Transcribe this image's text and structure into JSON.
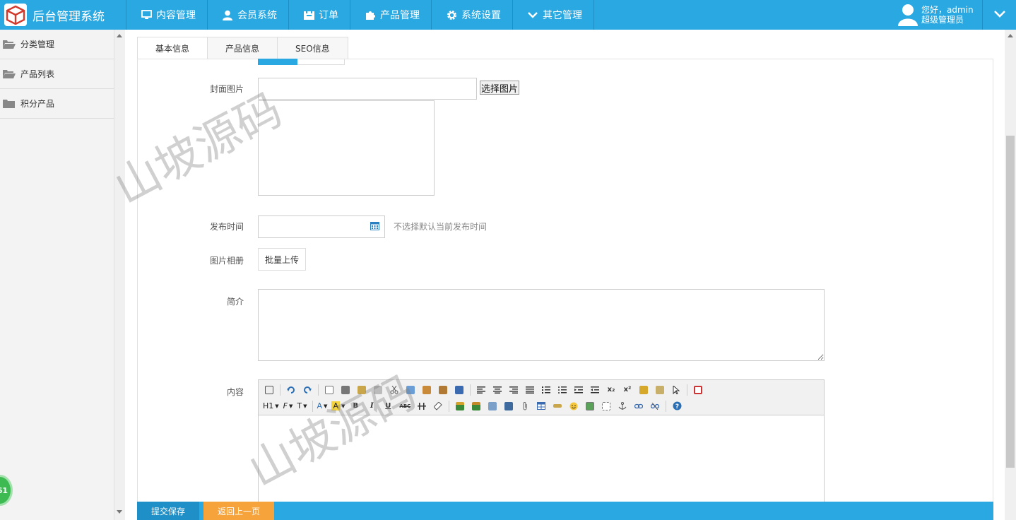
{
  "app": {
    "title": "后台管理系统"
  },
  "nav": {
    "items": [
      {
        "label": "内容管理",
        "icon": "monitor-icon"
      },
      {
        "label": "会员系统",
        "icon": "user-icon"
      },
      {
        "label": "订单",
        "icon": "order-icon"
      },
      {
        "label": "产品管理",
        "icon": "puzzle-icon"
      },
      {
        "label": "系统设置",
        "icon": "gear-icon"
      },
      {
        "label": "其它管理",
        "icon": "chevron-down-icon"
      }
    ]
  },
  "user": {
    "greeting": "您好，admin",
    "role": "超级管理员"
  },
  "sidebar": {
    "items": [
      {
        "label": "分类管理",
        "icon": "folder-open-icon"
      },
      {
        "label": "产品列表",
        "icon": "folder-open-icon"
      },
      {
        "label": "积分产品",
        "icon": "folder-icon"
      }
    ],
    "badge": "61"
  },
  "tabs": [
    {
      "label": "基本信息"
    },
    {
      "label": "产品信息"
    },
    {
      "label": "SEO信息"
    }
  ],
  "form": {
    "cover_label": "封面图片",
    "cover_value": "",
    "cover_button": "选择图片",
    "publish_label": "发布时间",
    "publish_value": "",
    "publish_hint": "不选择默认当前发布时间",
    "album_label": "图片相册",
    "album_button": "批量上传",
    "intro_label": "简介",
    "intro_value": "",
    "content_label": "内容"
  },
  "editor": {
    "heading_label": "H1",
    "font_label": "F",
    "size_label": "T",
    "color_label": "A",
    "highlight_label": "A",
    "bold_label": "B",
    "italic_label": "I",
    "underline_label": "U",
    "strike_label": "ABC",
    "sub_label": "x₂",
    "sup_label": "x²"
  },
  "actions": {
    "submit": "提交保存",
    "back": "返回上一页"
  },
  "watermark": "山坡源码",
  "colors": {
    "primary": "#2aa8e2",
    "back_button": "#f7a33b",
    "submit_button": "#1f8fc7"
  }
}
